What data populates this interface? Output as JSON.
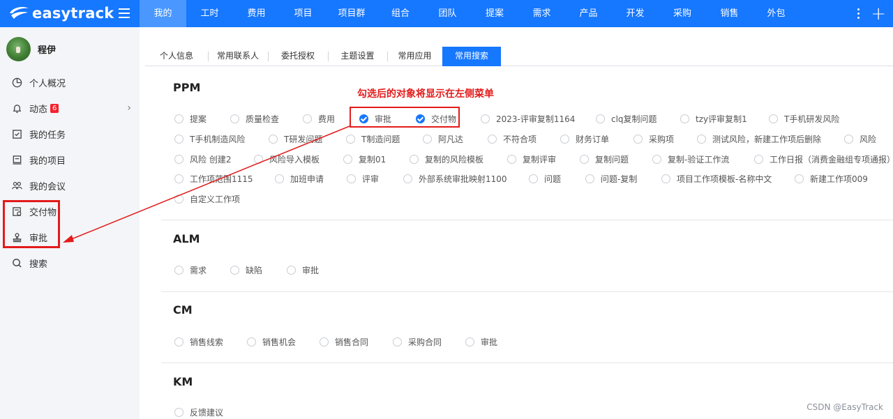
{
  "app": {
    "logo_text": "easytrack"
  },
  "nav": {
    "items": [
      {
        "label": "我的",
        "active": true
      },
      {
        "label": "工时"
      },
      {
        "label": "费用"
      },
      {
        "label": "项目"
      },
      {
        "label": "项目群"
      },
      {
        "label": "组合"
      },
      {
        "label": "团队"
      },
      {
        "label": "提案"
      },
      {
        "label": "需求"
      },
      {
        "label": "产品"
      },
      {
        "label": "开发"
      },
      {
        "label": "采购"
      },
      {
        "label": "销售"
      },
      {
        "label": "外包"
      }
    ]
  },
  "sidebar": {
    "user_name": "程伊",
    "items": [
      {
        "label": "个人概况",
        "icon": "pie-chart-icon"
      },
      {
        "label": "动态",
        "icon": "bell-icon",
        "badge": "6"
      },
      {
        "label": "我的任务",
        "icon": "task-check-icon"
      },
      {
        "label": "我的项目",
        "icon": "project-icon"
      },
      {
        "label": "我的会议",
        "icon": "meeting-icon"
      },
      {
        "label": "交付物",
        "icon": "deliverable-icon"
      },
      {
        "label": "审批",
        "icon": "approval-stamp-icon"
      },
      {
        "label": "搜索",
        "icon": "search-icon"
      }
    ]
  },
  "tabs": [
    {
      "label": "个人信息"
    },
    {
      "label": "常用联系人"
    },
    {
      "label": "委托授权"
    },
    {
      "label": "主题设置"
    },
    {
      "label": "常用应用"
    },
    {
      "label": "常用搜索",
      "active": true
    }
  ],
  "sections": {
    "ppm": {
      "title": "PPM",
      "options": [
        {
          "label": "提案",
          "checked": false
        },
        {
          "label": "质量检查",
          "checked": false
        },
        {
          "label": "费用",
          "checked": false
        },
        {
          "label": "审批",
          "checked": true
        },
        {
          "label": "交付物",
          "checked": true
        },
        {
          "label": "2023-评审复制1164",
          "checked": false
        },
        {
          "label": "clq复制问题",
          "checked": false
        },
        {
          "label": "tzy评审复制1",
          "checked": false
        },
        {
          "label": "T手机研发风险",
          "checked": false
        },
        {
          "label": "T手机制造风险",
          "checked": false
        },
        {
          "label": "T研发问题",
          "checked": false
        },
        {
          "label": "T制造问题",
          "checked": false
        },
        {
          "label": "阿凡达",
          "checked": false
        },
        {
          "label": "不符合项",
          "checked": false
        },
        {
          "label": "财务订单",
          "checked": false
        },
        {
          "label": "采购项",
          "checked": false
        },
        {
          "label": "测试风险，新建工作项后删除",
          "checked": false
        },
        {
          "label": "风险",
          "checked": false
        },
        {
          "label": "风险 创建2",
          "checked": false
        },
        {
          "label": "风险导入模板",
          "checked": false
        },
        {
          "label": "复制01",
          "checked": false
        },
        {
          "label": "复制的风险模板",
          "checked": false
        },
        {
          "label": "复制评审",
          "checked": false
        },
        {
          "label": "复制问题",
          "checked": false
        },
        {
          "label": "复制-验证工作流",
          "checked": false
        },
        {
          "label": "工作日报（消费金融组专项通报）",
          "checked": false
        },
        {
          "label": "工作项范围1115",
          "checked": false
        },
        {
          "label": "加班申请",
          "checked": false
        },
        {
          "label": "评审",
          "checked": false
        },
        {
          "label": "外部系统审批映射1100",
          "checked": false
        },
        {
          "label": "问题",
          "checked": false
        },
        {
          "label": "问题-复制",
          "checked": false
        },
        {
          "label": "项目工作项模板-名称中文",
          "checked": false
        },
        {
          "label": "新建工作项009",
          "checked": false
        },
        {
          "label": "自定义工作项",
          "checked": false
        }
      ]
    },
    "alm": {
      "title": "ALM",
      "options": [
        {
          "label": "需求",
          "checked": false
        },
        {
          "label": "缺陷",
          "checked": false
        },
        {
          "label": "审批",
          "checked": false
        }
      ]
    },
    "cm": {
      "title": "CM",
      "options": [
        {
          "label": "销售线索",
          "checked": false
        },
        {
          "label": "销售机会",
          "checked": false
        },
        {
          "label": "销售合同",
          "checked": false
        },
        {
          "label": "采购合同",
          "checked": false
        },
        {
          "label": "审批",
          "checked": false
        }
      ]
    },
    "km": {
      "title": "KM",
      "options": [
        {
          "label": "反馈建议",
          "checked": false
        }
      ]
    }
  },
  "annotation": {
    "text": "勾选后的对象将显示在左侧菜单",
    "color": "#e31b1b"
  },
  "watermark": "CSDN @EasyTrack",
  "colors": {
    "brand": "#1677ff",
    "nav_active": "#4a98ff",
    "sidebar_bg": "#f3f5f8"
  }
}
